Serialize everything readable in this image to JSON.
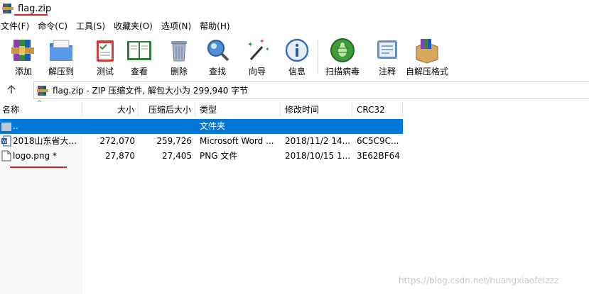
{
  "window": {
    "title": "flag.zip"
  },
  "menu": [
    "文件(F)",
    "命令(C)",
    "工具(S)",
    "收藏夹(O)",
    "选项(N)",
    "帮助(H)"
  ],
  "toolbar": [
    {
      "label": "添加",
      "icon": "add-archive-icon"
    },
    {
      "label": "解压到",
      "icon": "extract-to-icon"
    },
    {
      "label": "测试",
      "icon": "test-icon"
    },
    {
      "label": "查看",
      "icon": "view-book-icon"
    },
    {
      "label": "删除",
      "icon": "trash-icon"
    },
    {
      "label": "查找",
      "icon": "magnifier-icon"
    },
    {
      "label": "向导",
      "icon": "wizard-wand-icon"
    },
    {
      "label": "信息",
      "icon": "info-icon"
    },
    {
      "label": "扫描病毒",
      "icon": "virus-scan-icon"
    },
    {
      "label": "注释",
      "icon": "comment-icon"
    },
    {
      "label": "自解压格式",
      "icon": "sfx-box-icon"
    }
  ],
  "path": {
    "text": "flag.zip - ZIP 压缩文件, 解包大小为 299,940 字节"
  },
  "columns": [
    "名称",
    "大小",
    "压缩后大小",
    "类型",
    "修改时间",
    "CRC32"
  ],
  "rows": [
    {
      "name": "..",
      "size": "",
      "packed": "",
      "type": "文件夹",
      "modified": "",
      "crc": ""
    },
    {
      "name": "2018山东省大...",
      "size": "272,070",
      "packed": "259,726",
      "type": "Microsoft Word ...",
      "modified": "2018/11/2 14...",
      "crc": "6C5C9C..."
    },
    {
      "name": "logo.png *",
      "size": "27,870",
      "packed": "27,405",
      "type": "PNG 文件",
      "modified": "2018/10/15 1...",
      "crc": "3E62BF64"
    }
  ],
  "watermark": "https://blog.csdn.net/huangxiaofeizzz",
  "colors": {
    "selection": "#0078d7",
    "annotation_red": "#e02020"
  }
}
